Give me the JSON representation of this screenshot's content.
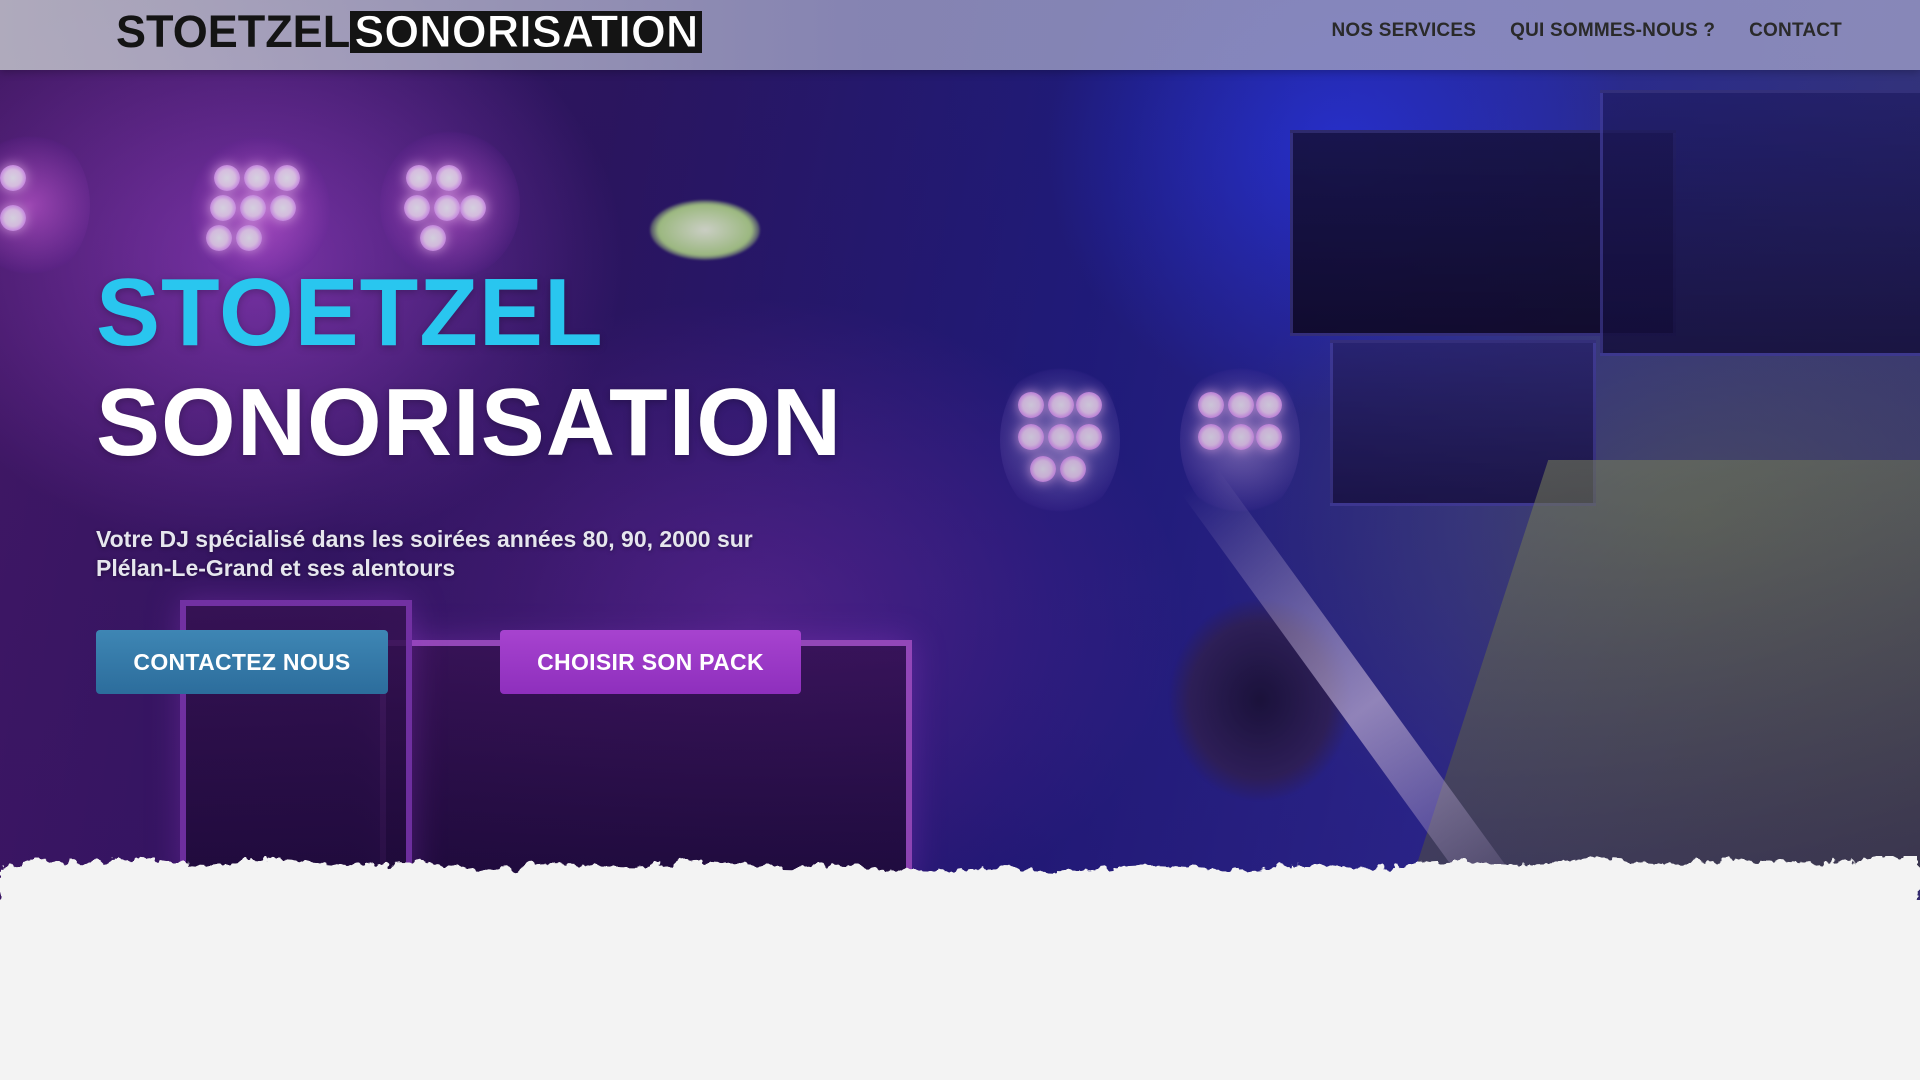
{
  "header": {
    "logo_part1": "STOETZEL",
    "logo_part2": "SONORISATION",
    "nav": [
      {
        "label": "NOS SERVICES"
      },
      {
        "label": "QUI SOMMES-NOUS ?"
      },
      {
        "label": "CONTACT"
      }
    ]
  },
  "hero": {
    "title_line1": "STOETZEL",
    "title_line2": "SONORISATION",
    "subtitle_line1": "Votre DJ spécialisé dans les soirées années 80, 90, 2000 sur",
    "subtitle_line2": "Plélan-Le-Grand et ses alentours",
    "buttons": {
      "contact": "CONTACTEZ NOUS",
      "pack": "CHOISIR SON PACK"
    }
  },
  "colors": {
    "title_accent": "#29c6ef",
    "contact_button": "#3579a8",
    "pack_button": "#9b3ac6",
    "page_background": "#f3f3f3"
  }
}
